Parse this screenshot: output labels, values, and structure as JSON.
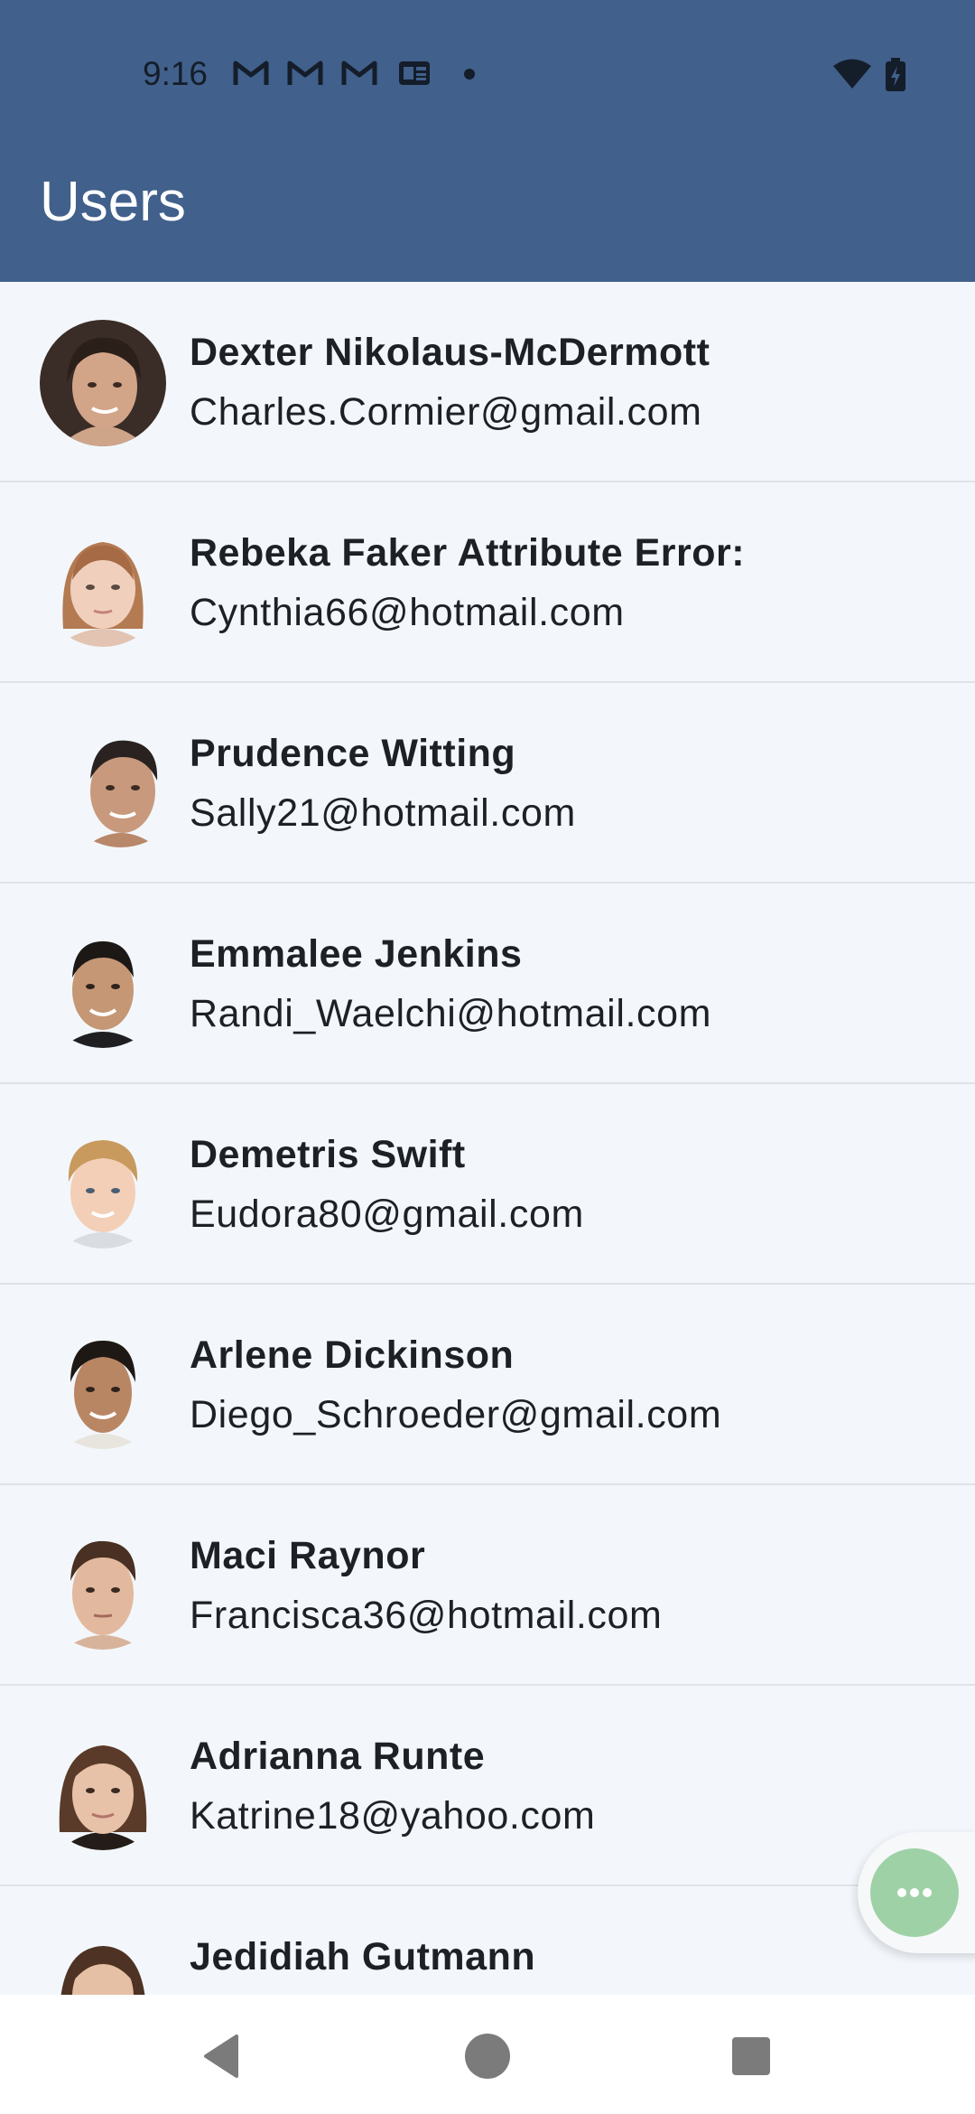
{
  "status_bar": {
    "time": "9:16",
    "icons": [
      "gmail-icon",
      "gmail-icon",
      "gmail-icon",
      "news-icon",
      "dot-icon",
      "wifi-icon",
      "battery-icon"
    ]
  },
  "app_bar": {
    "title": "Users",
    "color": "#41608b"
  },
  "users": [
    {
      "name": "Dexter Nikolaus-McDermott",
      "email": "Charles.Cormier@gmail.com"
    },
    {
      "name": "Rebeka Faker Attribute Error:",
      "email": "Cynthia66@hotmail.com"
    },
    {
      "name": "Prudence Witting",
      "email": "Sally21@hotmail.com"
    },
    {
      "name": "Emmalee Jenkins",
      "email": "Randi_Waelchi@hotmail.com"
    },
    {
      "name": "Demetris Swift",
      "email": "Eudora80@gmail.com"
    },
    {
      "name": "Arlene Dickinson",
      "email": "Diego_Schroeder@gmail.com"
    },
    {
      "name": "Maci Raynor",
      "email": "Francisca36@hotmail.com"
    },
    {
      "name": "Adrianna Runte",
      "email": "Katrine18@yahoo.com"
    },
    {
      "name": "Jedidiah Gutmann",
      "email": ""
    }
  ],
  "fab": {
    "icon": "more-horizontal-icon",
    "color": "#9fd1a6"
  },
  "nav_bar": {
    "buttons": [
      "back-icon",
      "home-icon",
      "recents-icon"
    ]
  }
}
